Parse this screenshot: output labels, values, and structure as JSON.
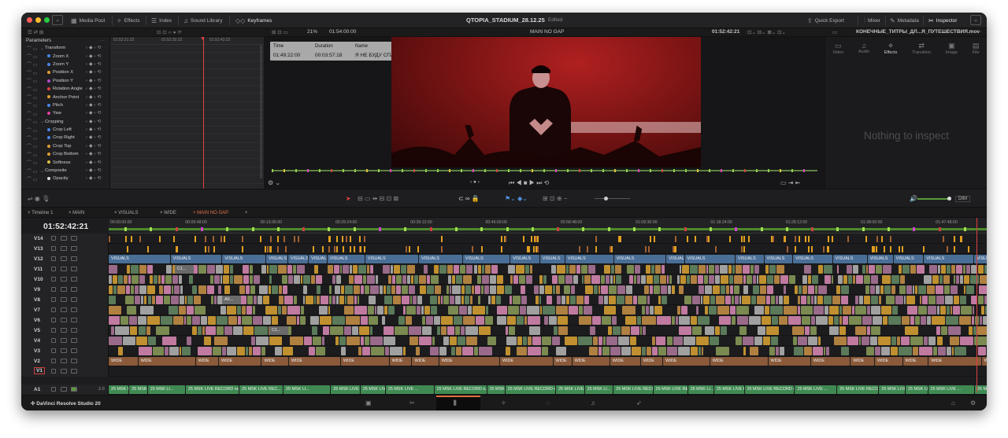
{
  "app": {
    "project_title": "QTOPIA_STADIUM_28.12.25",
    "status": "Edited",
    "brand": "DaVinci Resolve Studio 20"
  },
  "toolbar": {
    "media_pool": "Media Pool",
    "effects": "Effects",
    "index": "Index",
    "sound_library": "Sound Library",
    "keyframes": "Keyframes",
    "quick_export": "Quick Export",
    "mixer": "Mixer",
    "metadata": "Metadata",
    "inspector": "Inspector"
  },
  "viewer_bar": {
    "zoom": "21%",
    "duration_tc": "01:54:00:00",
    "timeline_name": "MAIN NO GAP",
    "record_tc": "01:52:42:21",
    "clip_name": "КОНЕЧНЫЕ_ТИТРЫ_ДЛ...Я_ПУТЕШЕСТВИЯ.mov"
  },
  "params": {
    "header": "Parameters",
    "rows": [
      {
        "label": "Transform",
        "group": true
      },
      {
        "label": "Zoom X",
        "color": "#4a86e8"
      },
      {
        "label": "Zoom Y",
        "color": "#4a86e8"
      },
      {
        "label": "Position X",
        "color": "#e0a030"
      },
      {
        "label": "Position Y",
        "color": "#b04ad0"
      },
      {
        "label": "Rotation Angle",
        "color": "#e04040"
      },
      {
        "label": "Anchor Point",
        "color": "#e0a030"
      },
      {
        "label": "Pitch",
        "color": "#4a86e8"
      },
      {
        "label": "Yaw",
        "color": "#e040a0"
      },
      {
        "label": "Cropping",
        "group": true
      },
      {
        "label": "Crop Left",
        "color": "#4a86e8"
      },
      {
        "label": "Crop Right",
        "color": "#4a86e8"
      },
      {
        "label": "Crop Top",
        "color": "#e0a030"
      },
      {
        "label": "Crop Bottom",
        "color": "#e0a030"
      },
      {
        "label": "Softness",
        "color": "#e0c040"
      },
      {
        "label": "Composite",
        "group": true
      },
      {
        "label": "Opacity",
        "color": "#dddddd"
      }
    ]
  },
  "keyframe_ruler": [
    "01:52:21:22",
    "01:52:32:22",
    "01:52:43:22"
  ],
  "overlay": {
    "time_label": "Time",
    "time_value": "01:49:22:00",
    "duration_label": "Duration",
    "duration_value": "00:03:57:18",
    "name_label": "Name",
    "name_value": "Я НЕ БУДУ СПАТЬ (L..."
  },
  "inspector": {
    "tabs": [
      "Video",
      "Audio",
      "Effects",
      "Transition",
      "Image",
      "File"
    ],
    "active_tab": "Effects",
    "empty_text": "Nothing to inspect"
  },
  "dim_label": "DIM",
  "timeline_tabs": [
    "Timeline 1",
    "MAIN",
    "VISUALS",
    "WIDE",
    "MAIN NO GAP"
  ],
  "timecode": "01:52:42:21",
  "ruler": [
    "00:00:00:00",
    "00:09:48:00",
    "00:19:36:00",
    "00:29:24:00",
    "00:39:12:00",
    "00:49:00:00",
    "00:58:48:00",
    "01:08:36:00",
    "01:18:24:00",
    "01:28:12:00",
    "01:38:00:00",
    "01:47:48:00"
  ],
  "tracks": [
    "V14",
    "V13",
    "V12",
    "V11",
    "V10",
    "V9",
    "V8",
    "V7",
    "V6",
    "V5",
    "V4",
    "V3",
    "V2",
    "V1",
    "A1"
  ],
  "audio_level": "2.0",
  "v12_label": "VISUALS",
  "v2_label": "WIDE",
  "a1_labels": [
    "25 MSK LIVE RECORD no ...",
    "25 MSK LIVE ...",
    "25 MSK LI...",
    "25 MSK LIVE RECORD no ...",
    "25 MSK LIVE REC...",
    "25 MSK LI...",
    "25 MSK LIVE RECORD no g...",
    "25 MSK LIVE RECORD no gate.wav",
    "25 MSK LIVE ...",
    "25 MSK LIVE RECORD n...",
    "25 MSK LIVE ..."
  ],
  "clip_codes": [
    "A0...",
    "C07...",
    "C00...",
    "C1...",
    "C0...",
    "D2..."
  ],
  "pages": [
    "media",
    "cut",
    "edit",
    "fusion",
    "color",
    "fairlight",
    "deliver"
  ]
}
